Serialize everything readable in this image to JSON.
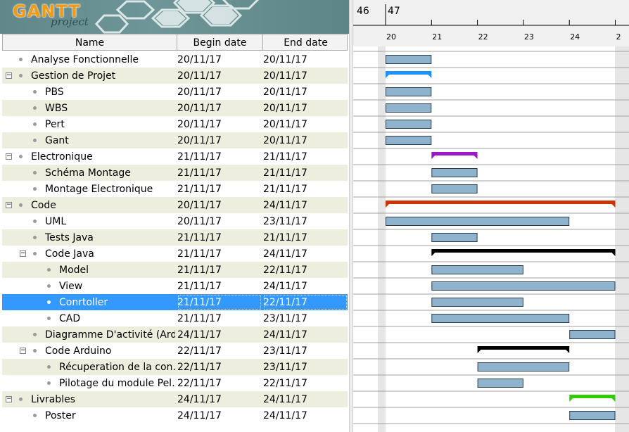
{
  "app": {
    "logo": {
      "gantt": "GANTT",
      "project": "project"
    }
  },
  "table": {
    "columns": {
      "name": "Name",
      "begin": "Begin date",
      "end": "End date"
    },
    "rows": [
      {
        "name": "Analyse Fonctionnelle",
        "begin": "20/11/17",
        "end": "20/11/17",
        "level": 0,
        "expandable": false,
        "selected": false
      },
      {
        "name": "Gestion de Projet",
        "begin": "20/11/17",
        "end": "20/11/17",
        "level": 0,
        "expandable": true,
        "selected": false
      },
      {
        "name": "PBS",
        "begin": "20/11/17",
        "end": "20/11/17",
        "level": 1,
        "expandable": false,
        "selected": false
      },
      {
        "name": "WBS",
        "begin": "20/11/17",
        "end": "20/11/17",
        "level": 1,
        "expandable": false,
        "selected": false
      },
      {
        "name": "Pert",
        "begin": "20/11/17",
        "end": "20/11/17",
        "level": 1,
        "expandable": false,
        "selected": false
      },
      {
        "name": "Gant",
        "begin": "20/11/17",
        "end": "20/11/17",
        "level": 1,
        "expandable": false,
        "selected": false
      },
      {
        "name": "Electronique",
        "begin": "21/11/17",
        "end": "21/11/17",
        "level": 0,
        "expandable": true,
        "selected": false
      },
      {
        "name": "Schéma Montage",
        "begin": "21/11/17",
        "end": "21/11/17",
        "level": 1,
        "expandable": false,
        "selected": false
      },
      {
        "name": "Montage Electronique",
        "begin": "21/11/17",
        "end": "21/11/17",
        "level": 1,
        "expandable": false,
        "selected": false
      },
      {
        "name": "Code",
        "begin": "20/11/17",
        "end": "24/11/17",
        "level": 0,
        "expandable": true,
        "selected": false
      },
      {
        "name": "UML",
        "begin": "20/11/17",
        "end": "23/11/17",
        "level": 1,
        "expandable": false,
        "selected": false
      },
      {
        "name": "Tests Java",
        "begin": "21/11/17",
        "end": "21/11/17",
        "level": 1,
        "expandable": false,
        "selected": false
      },
      {
        "name": "Code Java",
        "begin": "21/11/17",
        "end": "24/11/17",
        "level": 1,
        "expandable": true,
        "selected": false
      },
      {
        "name": "Model",
        "begin": "21/11/17",
        "end": "22/11/17",
        "level": 2,
        "expandable": false,
        "selected": false
      },
      {
        "name": "View",
        "begin": "21/11/17",
        "end": "24/11/17",
        "level": 2,
        "expandable": false,
        "selected": false
      },
      {
        "name": "Conrtoller",
        "begin": "21/11/17",
        "end": "22/11/17",
        "level": 2,
        "expandable": false,
        "selected": true
      },
      {
        "name": "CAD",
        "begin": "21/11/17",
        "end": "23/11/17",
        "level": 2,
        "expandable": false,
        "selected": false
      },
      {
        "name": "Diagramme D'activité (Ard…",
        "begin": "24/11/17",
        "end": "24/11/17",
        "level": 1,
        "expandable": false,
        "selected": false
      },
      {
        "name": "Code Arduino",
        "begin": "22/11/17",
        "end": "23/11/17",
        "level": 1,
        "expandable": true,
        "selected": false
      },
      {
        "name": "Récuperation de la con…",
        "begin": "22/11/17",
        "end": "23/11/17",
        "level": 2,
        "expandable": false,
        "selected": false
      },
      {
        "name": "Pilotage du module Pel…",
        "begin": "22/11/17",
        "end": "22/11/17",
        "level": 2,
        "expandable": false,
        "selected": false
      },
      {
        "name": "Livrables",
        "begin": "24/11/17",
        "end": "24/11/17",
        "level": 0,
        "expandable": true,
        "selected": false
      },
      {
        "name": "Poster",
        "begin": "24/11/17",
        "end": "24/11/17",
        "level": 1,
        "expandable": false,
        "selected": false
      }
    ]
  },
  "timeline": {
    "weeks": [
      "46",
      "47"
    ],
    "days": [
      "20",
      "21",
      "22",
      "23",
      "24",
      "2"
    ],
    "bars": [
      {
        "start": 20,
        "end": 21,
        "kind": "task"
      },
      {
        "start": 20,
        "end": 21,
        "kind": "summary",
        "color": "#1e90ff"
      },
      {
        "start": 20,
        "end": 21,
        "kind": "task"
      },
      {
        "start": 20,
        "end": 21,
        "kind": "task"
      },
      {
        "start": 20,
        "end": 21,
        "kind": "task"
      },
      {
        "start": 20,
        "end": 21,
        "kind": "task"
      },
      {
        "start": 21,
        "end": 22,
        "kind": "summary",
        "color": "#9b19c8"
      },
      {
        "start": 21,
        "end": 22,
        "kind": "task"
      },
      {
        "start": 21,
        "end": 22,
        "kind": "task"
      },
      {
        "start": 20,
        "end": 25,
        "kind": "summary",
        "color": "#cc3300"
      },
      {
        "start": 20,
        "end": 24,
        "kind": "task"
      },
      {
        "start": 21,
        "end": 22,
        "kind": "task"
      },
      {
        "start": 21,
        "end": 25,
        "kind": "summary",
        "color": "#000000"
      },
      {
        "start": 21,
        "end": 23,
        "kind": "task"
      },
      {
        "start": 21,
        "end": 25,
        "kind": "task"
      },
      {
        "start": 21,
        "end": 23,
        "kind": "task"
      },
      {
        "start": 21,
        "end": 24,
        "kind": "task"
      },
      {
        "start": 24,
        "end": 25,
        "kind": "task"
      },
      {
        "start": 22,
        "end": 24,
        "kind": "summary",
        "color": "#000000"
      },
      {
        "start": 22,
        "end": 24,
        "kind": "task"
      },
      {
        "start": 22,
        "end": 23,
        "kind": "task"
      },
      {
        "start": 24,
        "end": 25,
        "kind": "summary",
        "color": "#33cc00"
      },
      {
        "start": 24,
        "end": 25,
        "kind": "task"
      }
    ],
    "colors": {
      "task_fill": "#8fb2cd",
      "task_stroke": "#2a3c4c",
      "weekend_band": "#e6e6e6",
      "row_line": "#a0a0a0"
    }
  }
}
